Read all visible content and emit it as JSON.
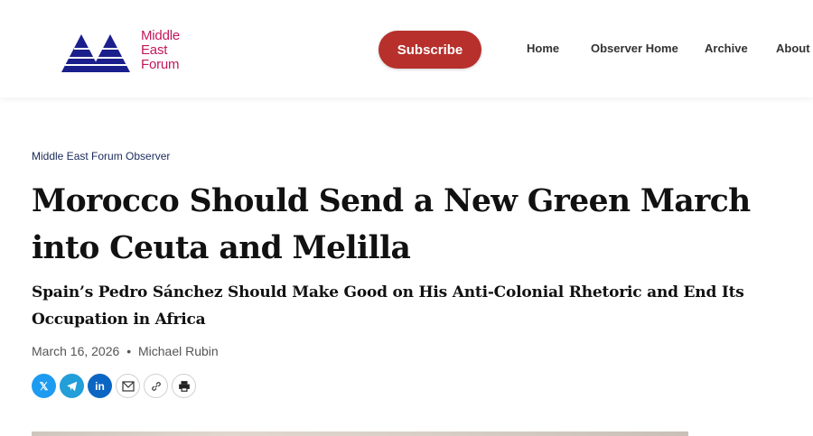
{
  "header": {
    "logo_lines": [
      "Middle",
      "East",
      "Forum"
    ],
    "subscribe_label": "Subscribe",
    "nav": [
      "Home",
      "Observer Home",
      "Archive",
      "About"
    ]
  },
  "article": {
    "category": "Middle East Forum Observer",
    "title": "Morocco Should Send a New Green March into Ceuta and Melilla",
    "subtitle": "Spain’s Pedro Sánchez Should Make Good on His Anti-Colonial Rhetoric and End Its Occupation in Africa",
    "date": "March 16, 2026",
    "separator": "•",
    "author": "Michael Rubin"
  },
  "share": {
    "x_glyph": "𝕏",
    "linkedin_glyph": "in"
  },
  "colors": {
    "logo_blue": "#1a1f8c",
    "logo_red": "#c2185b",
    "subscribe_bg": "#b7302c"
  }
}
